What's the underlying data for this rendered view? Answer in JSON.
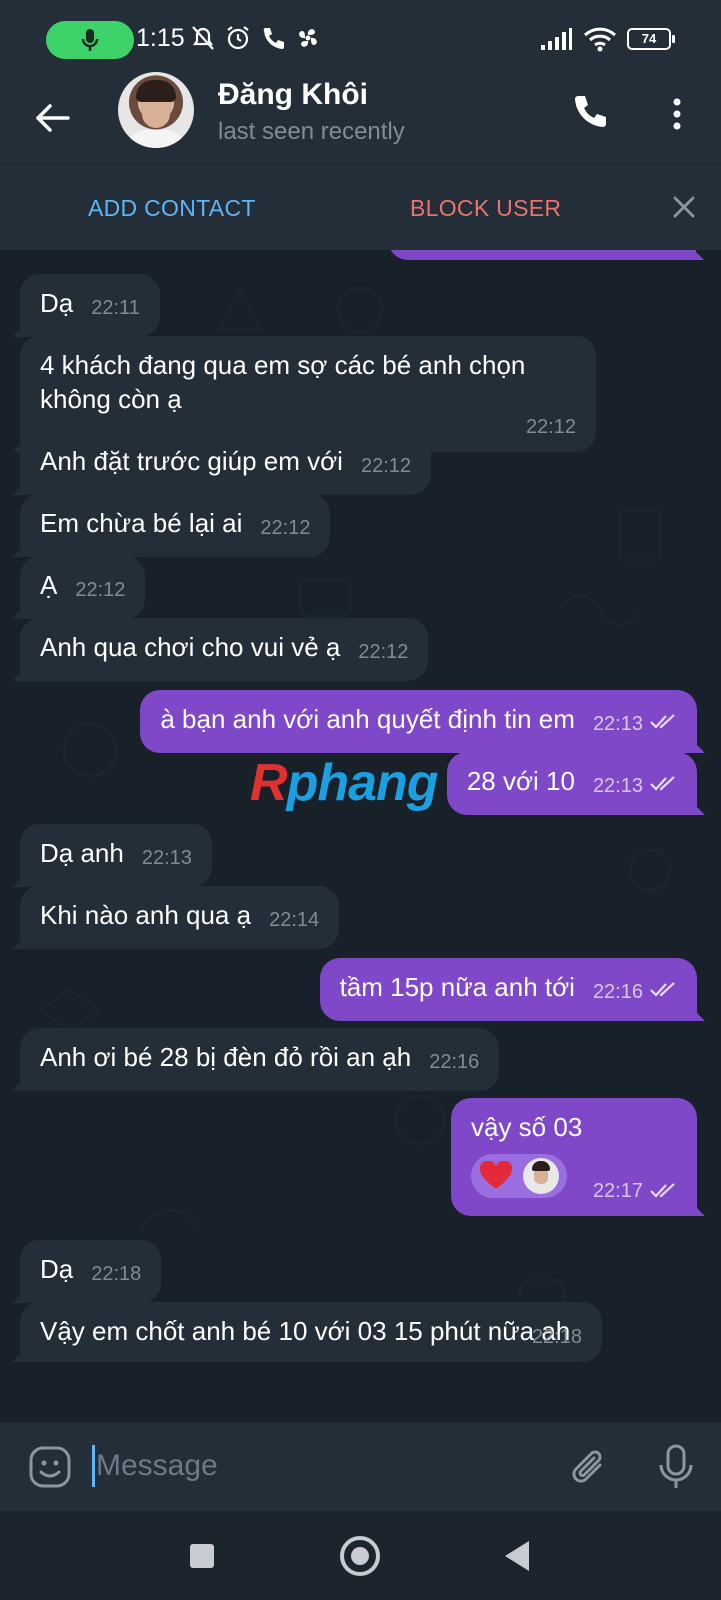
{
  "status_bar": {
    "time": "1:15",
    "battery": "74"
  },
  "header": {
    "name": "Đăng Khôi",
    "status": "last seen recently"
  },
  "action_bar": {
    "add_contact": "ADD CONTACT",
    "block_user": "BLOCK USER"
  },
  "messages": [
    {
      "dir": "in",
      "text": "Dạ",
      "time": "22:11"
    },
    {
      "dir": "in",
      "text": "4 khách đang qua em sợ các bé anh chọn không còn ạ",
      "time": "22:12"
    },
    {
      "dir": "in",
      "text": "Anh đặt trước giúp em với",
      "time": "22:12"
    },
    {
      "dir": "in",
      "text": "Em chừa bé lại ai",
      "time": "22:12"
    },
    {
      "dir": "in",
      "text": "Ạ",
      "time": "22:12"
    },
    {
      "dir": "in",
      "text": "Anh qua chơi cho vui vẻ ạ",
      "time": "22:12"
    },
    {
      "dir": "out",
      "text": "à bạn anh với anh quyết định tin em",
      "time": "22:13"
    },
    {
      "dir": "out",
      "text": "28 với 10",
      "time": "22:13"
    },
    {
      "dir": "in",
      "text": "Dạ anh",
      "time": "22:13"
    },
    {
      "dir": "in",
      "text": "Khi nào anh qua ạ",
      "time": "22:14"
    },
    {
      "dir": "out",
      "text": "tầm 15p nữa anh tới",
      "time": "22:16"
    },
    {
      "dir": "in",
      "text": "Anh ơi bé 28 bị đèn đỏ rồi an ạh",
      "time": "22:16"
    },
    {
      "dir": "out",
      "text": "vậy số 03",
      "time": "22:17",
      "reaction": "heart"
    },
    {
      "dir": "in",
      "text": "Dạ",
      "time": "22:18"
    },
    {
      "dir": "in",
      "text": "Vậy em chốt anh bé 10 với 03 15 phút nữa ah",
      "time": "22:18"
    }
  ],
  "watermark": {
    "r": "R",
    "rest": "phang"
  },
  "composer": {
    "placeholder": "Message"
  },
  "icons": {
    "back": "arrow-left-icon",
    "call": "phone-icon",
    "menu": "more-vertical-icon",
    "close": "close-icon",
    "emoji": "emoji-icon",
    "attach": "paperclip-icon",
    "mic": "microphone-icon"
  },
  "colors": {
    "accent": "#5eb5f7",
    "danger": "#e8746e",
    "outgoing": "#7e48c8",
    "incoming": "#232e38"
  }
}
